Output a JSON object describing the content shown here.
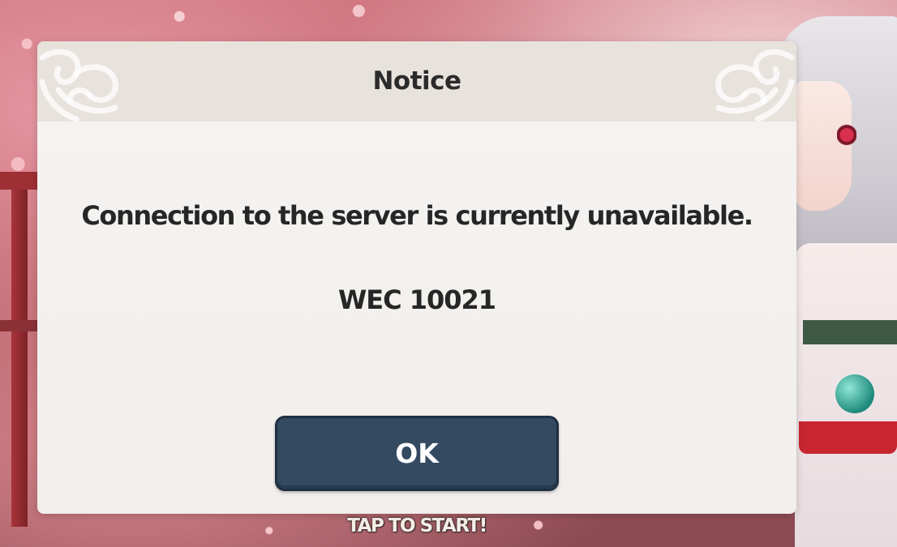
{
  "dialog": {
    "title": "Notice",
    "message": "Connection to the server is currently unavailable.",
    "error_code": "WEC 10021",
    "ok_label": "OK"
  },
  "background": {
    "prompt": "TAP TO START!"
  },
  "colors": {
    "dialog_bg": "#f3f1ee",
    "header_bg": "#e8e2dd",
    "button_bg": "#334a61",
    "button_border": "#1f3042",
    "text": "#262626"
  },
  "icons": {
    "header_ornament": "knot-ornament-icon"
  }
}
